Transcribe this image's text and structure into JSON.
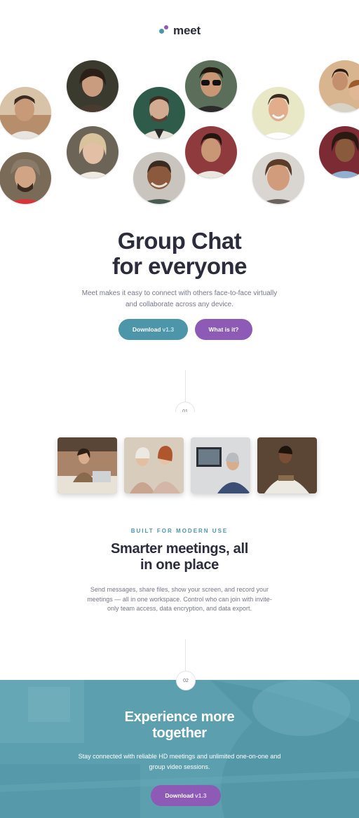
{
  "header": {
    "logo_text": "meet"
  },
  "hero": {
    "title_line1": "Group Chat",
    "title_line2": "for everyone",
    "description": "Meet makes it easy to connect with others face-to-face virtually and collaborate across any device.",
    "download_label": "Download",
    "download_version": "v1.3",
    "what_label": "What is it?"
  },
  "steps": {
    "first": "01",
    "second": "02"
  },
  "features": {
    "eyebrow": "BUILT FOR MODERN USE",
    "title_line1": "Smarter meetings, all",
    "title_line2": "in one place",
    "description": "Send messages, share files, show your screen, and record your meetings — all in one workspace. Control who can join with invite-only team access, data encryption, and data export."
  },
  "cta": {
    "title_line1": "Experience more",
    "title_line2": "together",
    "description": "Stay connected with reliable HD meetings and unlimited one-on-one and group video sessions.",
    "download_label": "Download",
    "download_version": "v1.3"
  },
  "colors": {
    "teal": "#4d96a9",
    "purple": "#8d5bb6",
    "dark_text": "#2c2c3d",
    "muted_text": "#77778a"
  },
  "avatars": [
    "avatar-photo-1",
    "avatar-photo-2",
    "avatar-photo-3",
    "avatar-photo-4",
    "avatar-photo-5",
    "avatar-photo-6",
    "avatar-photo-7",
    "avatar-photo-8",
    "avatar-photo-9",
    "avatar-photo-10",
    "avatar-photo-11",
    "avatar-photo-12",
    "avatar-photo-13",
    "avatar-photo-14"
  ],
  "photos": [
    "photo-woman-laptop",
    "photo-friends-phone",
    "photo-video-call",
    "photo-man-phone"
  ]
}
